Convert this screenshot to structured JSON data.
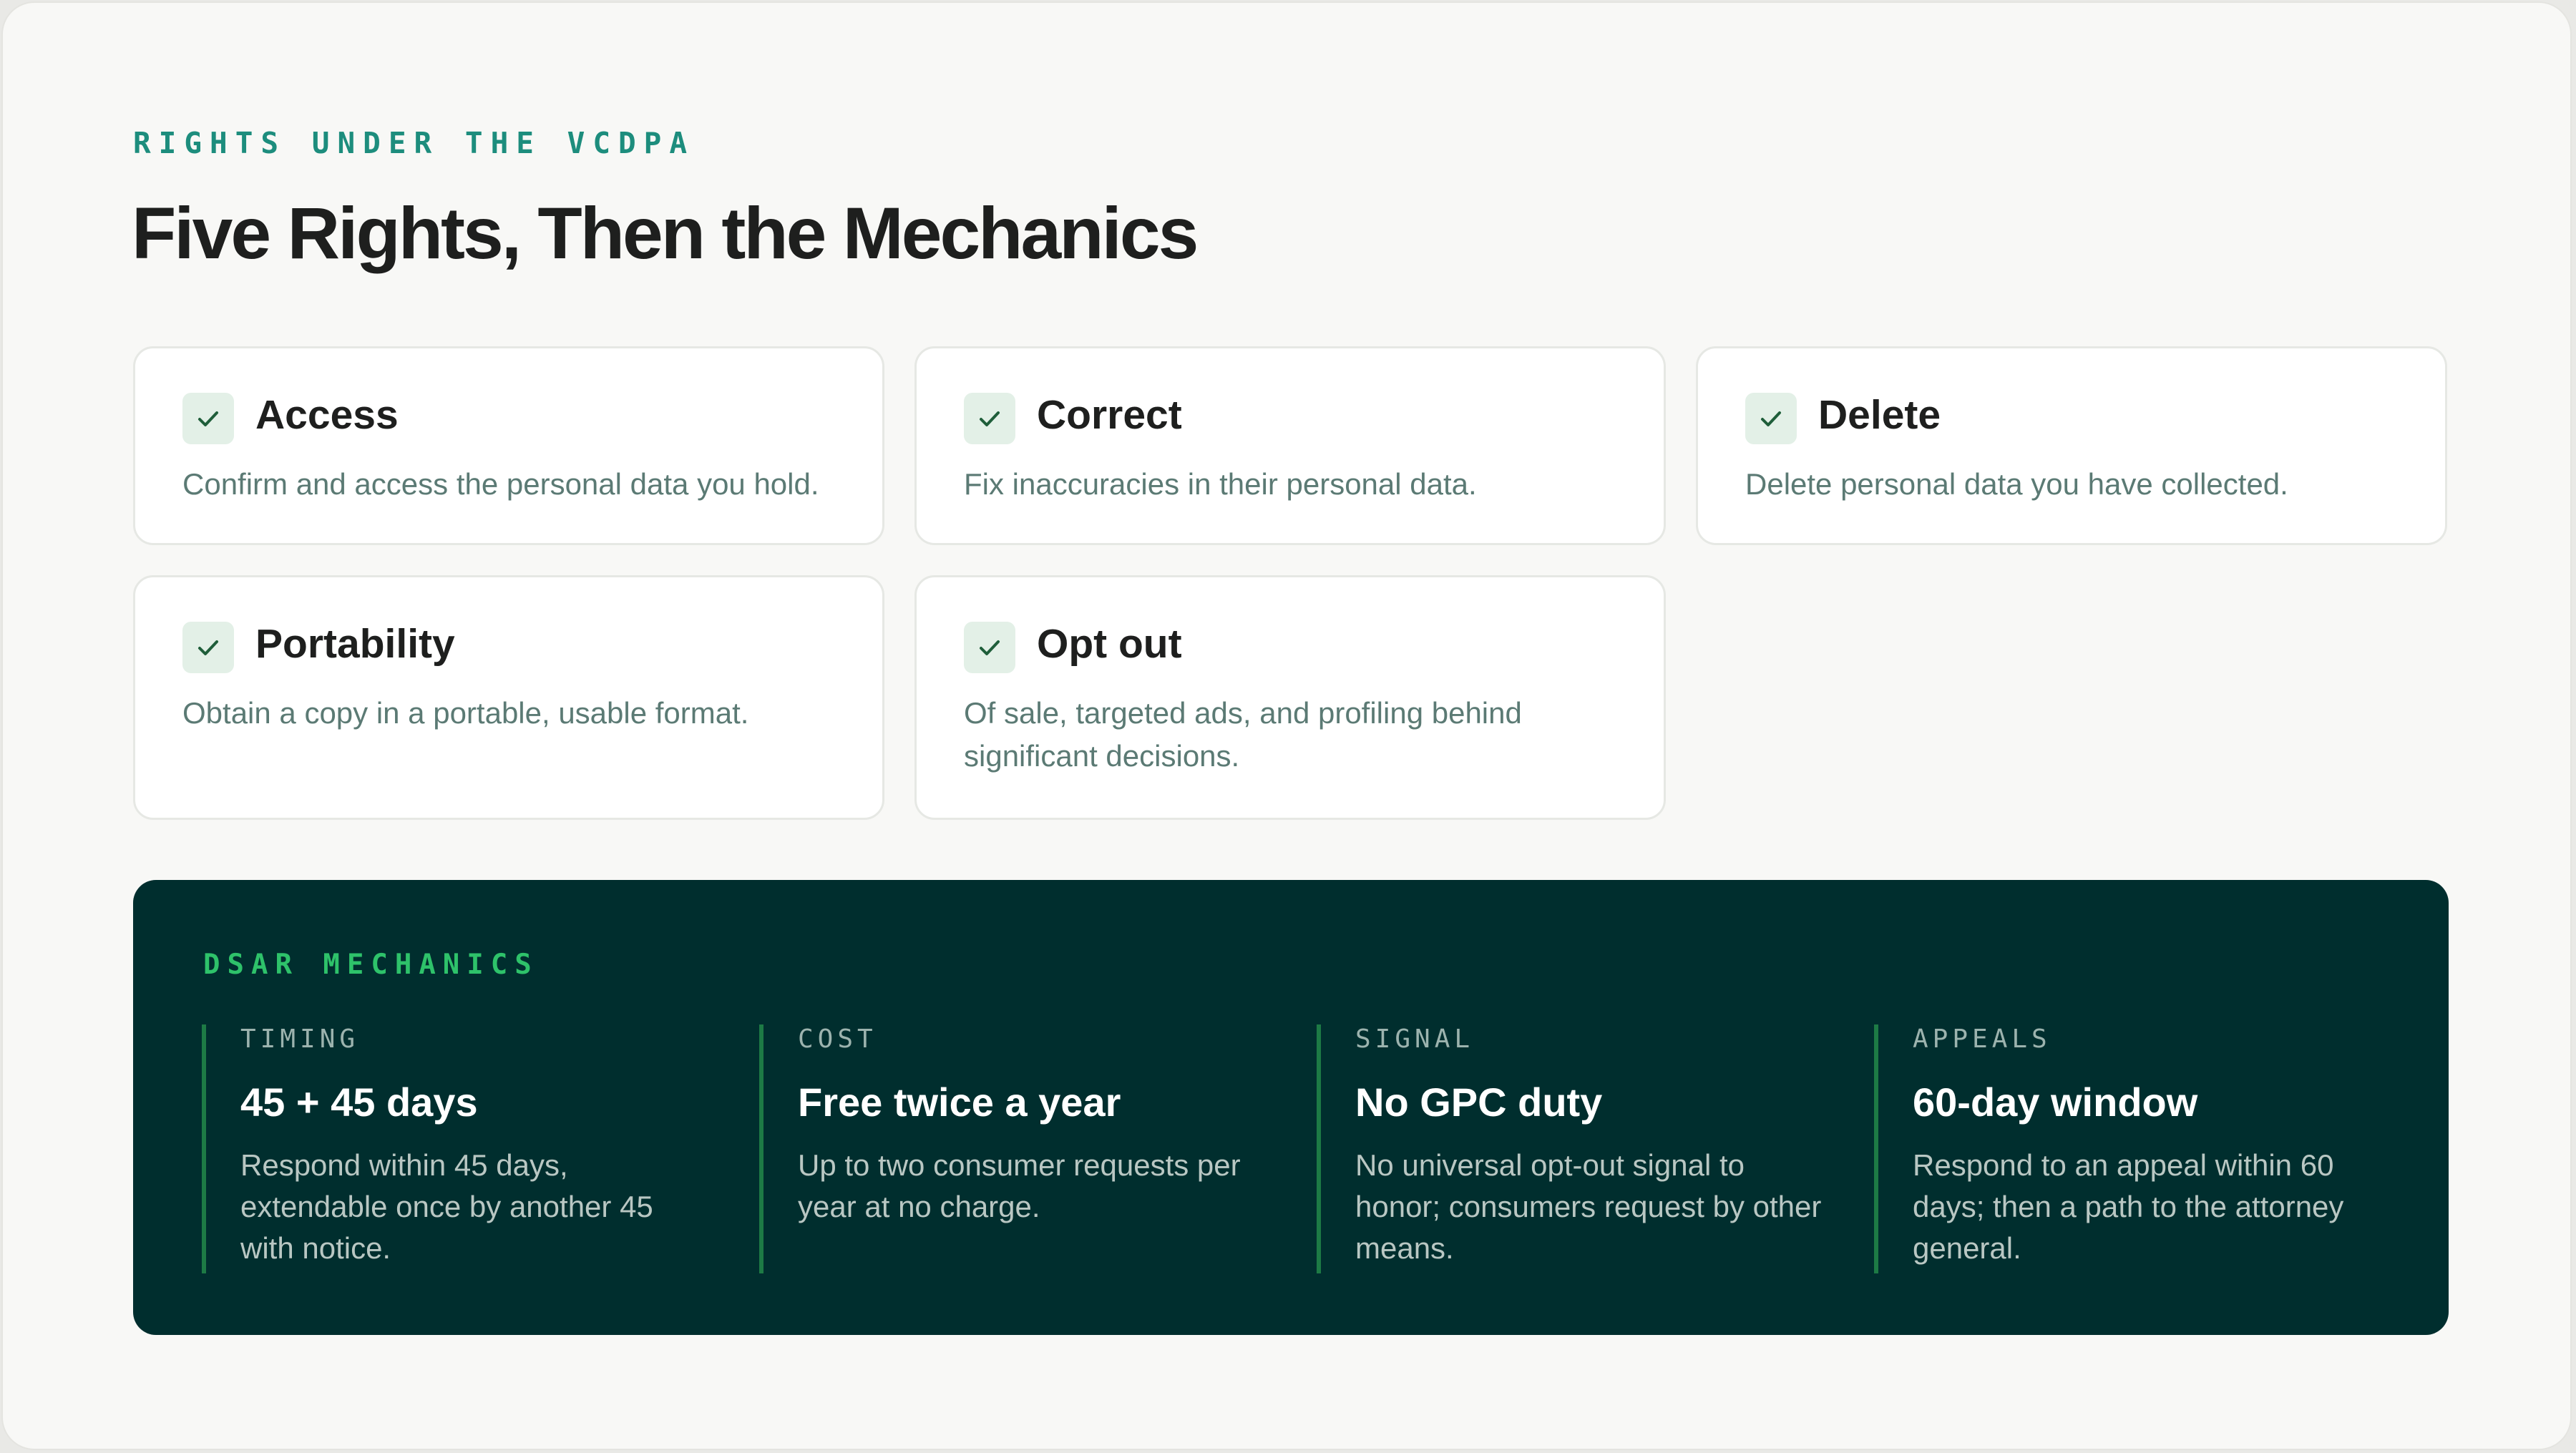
{
  "header": {
    "kicker": "RIGHTS UNDER THE VCDPA",
    "title": "Five Rights, Then the Mechanics"
  },
  "rights": [
    {
      "title": "Access",
      "desc": "Confirm and access the personal data you hold.",
      "icon": "check-icon"
    },
    {
      "title": "Correct",
      "desc": "Fix inaccuracies in their personal data.",
      "icon": "check-icon"
    },
    {
      "title": "Delete",
      "desc": "Delete personal data you have collected.",
      "icon": "check-icon"
    },
    {
      "title": "Portability",
      "desc": "Obtain a copy in a portable, usable format.",
      "icon": "check-icon"
    },
    {
      "title": "Opt out",
      "desc": "Of sale, targeted ads, and profiling behind significant decisions.",
      "icon": "check-icon"
    }
  ],
  "mechanics": {
    "kicker": "DSAR MECHANICS",
    "items": [
      {
        "label": "TIMING",
        "value": "45 + 45 days",
        "desc": "Respond within 45 days, extendable once by another 45 with notice."
      },
      {
        "label": "COST",
        "value": "Free twice a year",
        "desc": "Up to two consumer requests per year at no charge."
      },
      {
        "label": "SIGNAL",
        "value": "No GPC duty",
        "desc": "No universal opt-out signal to honor; consumers request by other means."
      },
      {
        "label": "APPEALS",
        "value": "60-day window",
        "desc": "Respond to an appeal within 60 days; then a path to the attorney general."
      }
    ]
  },
  "colors": {
    "accent": "#1d8d7d",
    "panel": "#002e2e",
    "panel_accent": "#2ec26a",
    "check_bg": "#e3f0e7"
  }
}
